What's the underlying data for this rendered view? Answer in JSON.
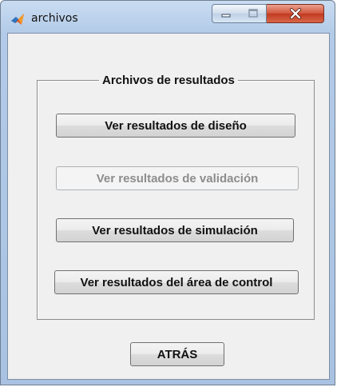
{
  "window": {
    "title": "archivos",
    "app_icon": "matlab-icon",
    "controls": {
      "minimize_icon": "minimize-icon",
      "maximize_icon": "maximize-icon",
      "close_icon": "close-icon"
    }
  },
  "panel": {
    "title": "Archivos de resultados",
    "buttons": [
      {
        "label": "Ver resultados de diseño",
        "enabled": true
      },
      {
        "label": "Ver resultados de validación",
        "enabled": false
      },
      {
        "label": "Ver resultados de simulación",
        "enabled": true
      },
      {
        "label": "Ver resultados del área de control",
        "enabled": true
      }
    ]
  },
  "footer": {
    "back_label": "ATRÁS"
  },
  "colors": {
    "frame": "#b3cbe8",
    "client_bg": "#f0f0f0",
    "close_red": "#c9452b",
    "disabled_text": "#8d8d8d"
  }
}
